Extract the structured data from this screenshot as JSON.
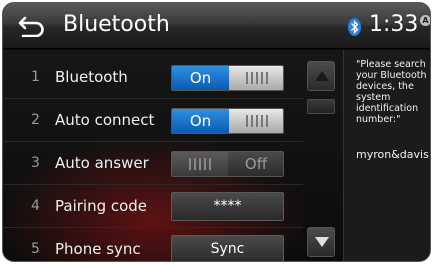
{
  "header": {
    "title": "Bluetooth",
    "time": "1:33",
    "alarm_badge": "A"
  },
  "rows": [
    {
      "num": "1",
      "label": "Bluetooth",
      "control": "toggle",
      "state": "On",
      "on_label": "On"
    },
    {
      "num": "2",
      "label": "Auto connect",
      "control": "toggle",
      "state": "On",
      "on_label": "On"
    },
    {
      "num": "3",
      "label": "Auto answer",
      "control": "toggle",
      "state": "Off",
      "off_label": "Off"
    },
    {
      "num": "4",
      "label": "Pairing code",
      "control": "button",
      "button_label": "****"
    },
    {
      "num": "5",
      "label": "Phone sync",
      "control": "button",
      "button_label": "Sync"
    }
  ],
  "side_panel": {
    "prompt": "\"Please search your Bluetooth devices, the system identification number:\"",
    "device_name": "myron&davis"
  },
  "icons": {
    "back": "back-arrow-icon",
    "bluetooth": "bluetooth-icon",
    "scroll_up": "triangle-up-icon",
    "scroll_down": "triangle-down-icon"
  },
  "colors": {
    "toggle_on": "#1a78d4",
    "bluetooth_icon": "#2a7fd6",
    "background_glow": "#a01414"
  }
}
